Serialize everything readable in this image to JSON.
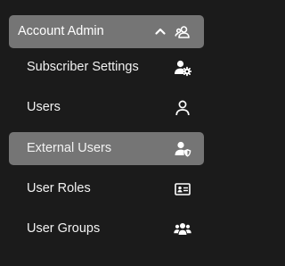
{
  "section": {
    "title": "Account Admin",
    "expanded": true,
    "toggle_icon": "chevron-up-icon",
    "icon": "users-group-outline-icon"
  },
  "items": [
    {
      "label": "Subscriber Settings",
      "icon": "user-gear-icon",
      "active": false
    },
    {
      "label": "Users",
      "icon": "user-outline-icon",
      "active": false
    },
    {
      "label": "External Users",
      "icon": "user-shield-icon",
      "active": true
    },
    {
      "label": "User Roles",
      "icon": "id-card-icon",
      "active": false
    },
    {
      "label": "User Groups",
      "icon": "users-icon",
      "active": false
    }
  ],
  "colors": {
    "background": "#1b1b1b",
    "selected_background": "#757575",
    "text": "#f2f2f2"
  }
}
